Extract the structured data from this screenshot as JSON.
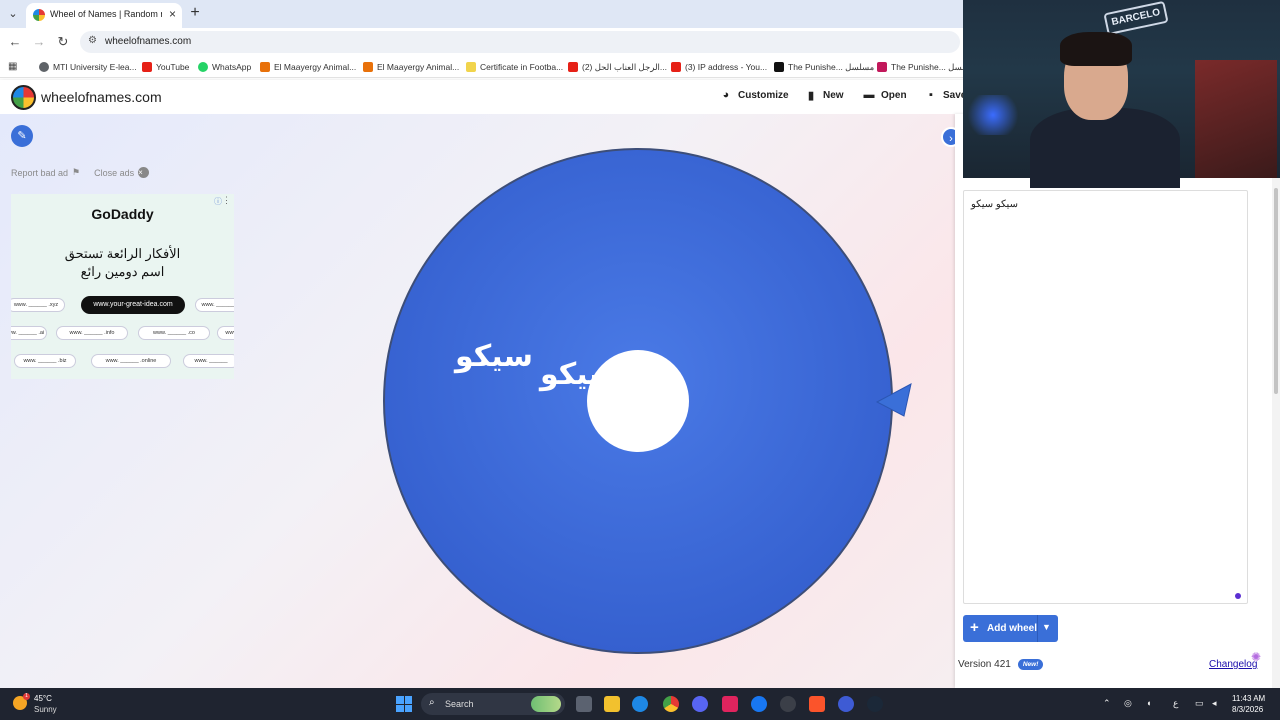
{
  "browser": {
    "tab_title": "Wheel of Names | Random name",
    "url": "wheelofnames.com",
    "bookmarks": [
      {
        "label": "MTI University E-lea...",
        "color": "#5f6368"
      },
      {
        "label": "YouTube",
        "color": "#e62117"
      },
      {
        "label": "WhatsApp",
        "color": "#25d366"
      },
      {
        "label": "El Maayergy Animal...",
        "color": "#e8710a"
      },
      {
        "label": "El Maayergy Animal...",
        "color": "#e8710a"
      },
      {
        "label": "Certificate in Footba...",
        "color": "#f1d44c"
      },
      {
        "label": "(2) الرجل العناب الحل...",
        "color": "#e62117"
      },
      {
        "label": "(3) IP address - You...",
        "color": "#e62117"
      },
      {
        "label": "The Punishe... مسلسل",
        "color": "#111111"
      },
      {
        "label": "The Punishe... مسلسل",
        "color": "#c2185b"
      }
    ]
  },
  "site": {
    "name": "wheelofnames.com",
    "nav": {
      "customize": "Customize",
      "new": "New",
      "open": "Open",
      "save": "Save"
    }
  },
  "ads": {
    "report": "Report bad ad",
    "close": "Close ads",
    "brand": "GoDaddy",
    "line1": "الأفكار الرائعة تستحق",
    "line2": "اسم دومين رائع",
    "main_domain": "www.your-great-idea.com",
    "pills": [
      "www. ______ .xyz",
      "www. ______",
      "www. ______ .ai",
      "www. ______ .info",
      "www. ______ .co",
      "www.",
      "www. ______ .biz",
      "www. ______ .online",
      "www. ______"
    ]
  },
  "wheel": {
    "color": "#3a6ad8",
    "entries": [
      "سيكو",
      "سيكو"
    ]
  },
  "panel": {
    "entries_text": "سيكو سيكو",
    "add_wheel": "Add wheel",
    "version": "Version 421",
    "new_badge": "New!",
    "changelog": "Changelog"
  },
  "webcam": {
    "sign": "BARCELO"
  },
  "taskbar": {
    "temperature": "45°C",
    "weather": "Sunny",
    "weather_badge": "1",
    "search": "Search",
    "time": "11:43 AM",
    "date": "8/3/2026",
    "lang": "ع"
  },
  "colors": {
    "accent": "#3a6fd8",
    "taskbar": "#1f2430"
  }
}
